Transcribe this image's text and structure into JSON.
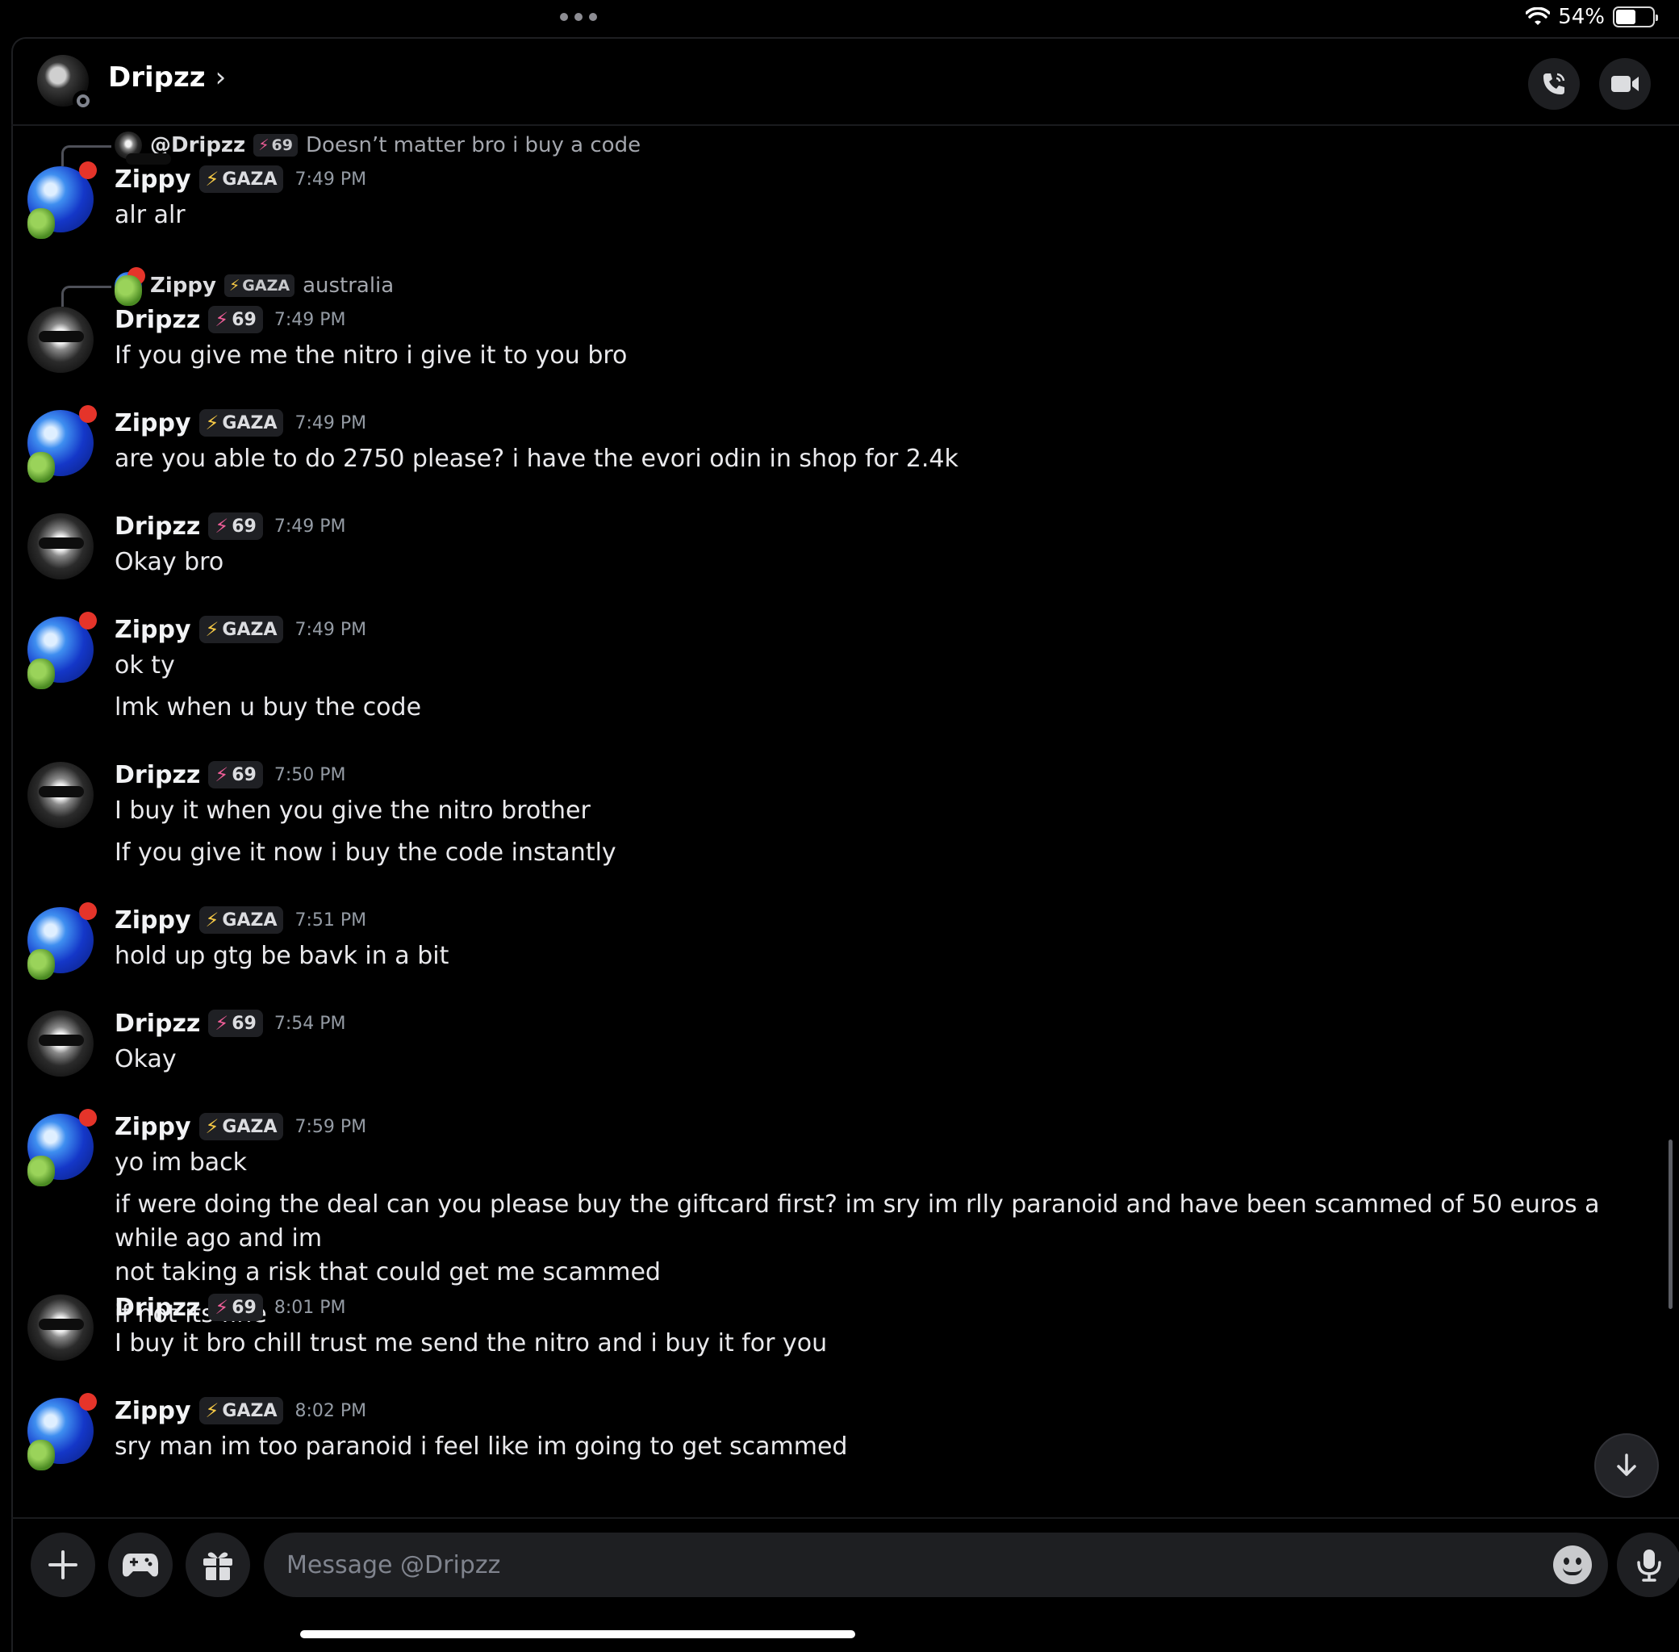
{
  "status_bar": {
    "battery": "54%"
  },
  "header": {
    "title": "Dripzz",
    "chevron": "›"
  },
  "replies": [
    {
      "name": "@Dripzz",
      "tag": "69",
      "text": "Doesn’t matter bro i buy a code"
    },
    {
      "name": "Zippy",
      "tag": "GAZA",
      "text": "australia"
    }
  ],
  "messages": [
    {
      "user": "Zippy",
      "tag": "GAZA",
      "time": "7:49 PM",
      "lines": [
        "alr alr"
      ]
    },
    {
      "user": "Dripzz",
      "tag": "69",
      "time": "7:49 PM",
      "lines": [
        "If you give me the nitro i give it to you bro"
      ]
    },
    {
      "user": "Zippy",
      "tag": "GAZA",
      "time": "7:49 PM",
      "lines": [
        "are you able to do 2750 please? i have the evori odin in shop for 2.4k"
      ]
    },
    {
      "user": "Dripzz",
      "tag": "69",
      "time": "7:49 PM",
      "lines": [
        "Okay bro"
      ]
    },
    {
      "user": "Zippy",
      "tag": "GAZA",
      "time": "7:49 PM",
      "lines": [
        "ok ty",
        "lmk when u buy the code"
      ]
    },
    {
      "user": "Dripzz",
      "tag": "69",
      "time": "7:50 PM",
      "lines": [
        "I buy it when you give the nitro brother",
        "If you give it now i buy the code instantly"
      ]
    },
    {
      "user": "Zippy",
      "tag": "GAZA",
      "time": "7:51 PM",
      "lines": [
        "hold up gtg be bavk in a bit"
      ]
    },
    {
      "user": "Dripzz",
      "tag": "69",
      "time": "7:54 PM",
      "lines": [
        "Okay"
      ]
    },
    {
      "user": "Zippy",
      "tag": "GAZA",
      "time": "7:59 PM",
      "lines": [
        "yo im back",
        "if were doing the deal can you please buy the giftcard first? im sry im rlly paranoid and have been scammed of 50 euros a while ago and im",
        "not taking a risk that could get me scammed",
        "if not its fine"
      ]
    },
    {
      "user": "Dripzz",
      "tag": "69",
      "time": "8:01 PM",
      "lines": [
        "I buy it bro chill trust me send the nitro and i buy it for you"
      ]
    },
    {
      "user": "Zippy",
      "tag": "GAZA",
      "time": "8:02 PM",
      "lines": [
        "sry man im too paranoid i feel like im going to get scammed"
      ]
    }
  ],
  "composer": {
    "placeholder": "Message @Dripzz"
  },
  "colors": {
    "background": "#000000",
    "surface": "#1e1f22",
    "gaza_bolt": "#f6c945",
    "nitro_bolt": "#ee5d97",
    "timestamp": "#949ba4"
  }
}
